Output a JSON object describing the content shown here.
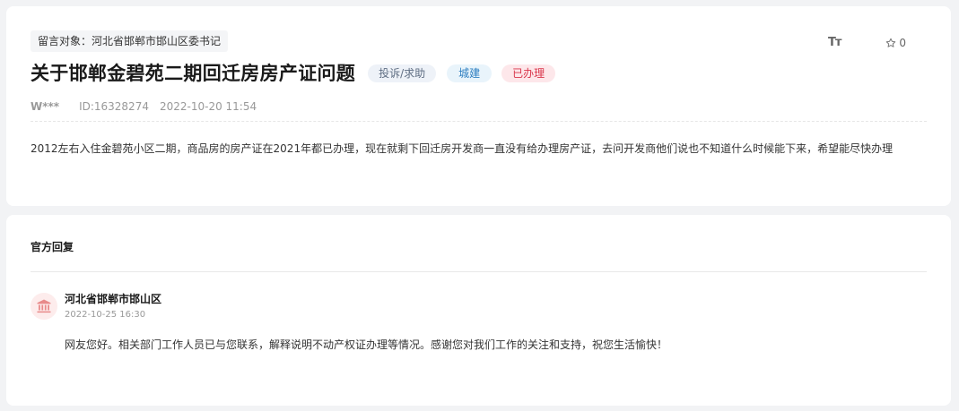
{
  "message": {
    "target": "留言对象：河北省邯郸市邯山区委书记",
    "title": "关于邯郸金碧苑二期回迁房房产证问题",
    "tags": {
      "type": "投诉/求助",
      "category": "城建",
      "status": "已办理"
    },
    "user": "W***",
    "id": "ID:16328274",
    "time": "2022-10-20 11:54",
    "content": "2012左右入住金碧苑小区二期，商品房的房产证在2021年都已办理，现在就剩下回迁房开发商一直没有给办理房产证，去问开发商他们说也不知道什么时候能下来，希望能尽快办理"
  },
  "toolbar": {
    "font_size_icon": "font-size-icon",
    "font_label": "Tт",
    "favorite_icon": "star-outline-icon",
    "favorite_count": "0"
  },
  "reply": {
    "section_title": "官方回复",
    "avatar_icon": "government-building-icon",
    "replier": "河北省邯郸市邯山区",
    "time": "2022-10-25 16:30",
    "content": "网友您好。相关部门工作人员已与您联系，解释说明不动产权证办理等情况。感谢您对我们工作的关注和支持，祝您生活愉快！"
  },
  "colors": {
    "status_red": "#d9364b",
    "category_blue": "#2f7fc1",
    "avatar_bg": "#fdecec",
    "avatar_icon": "#e88a8a"
  }
}
